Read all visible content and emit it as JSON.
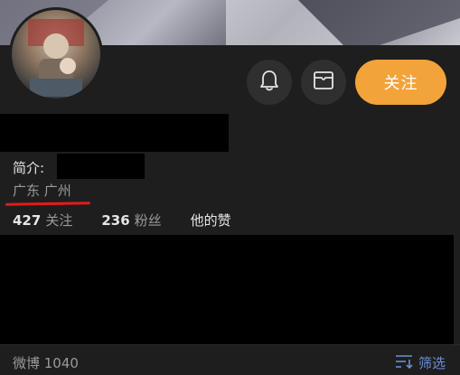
{
  "profile": {
    "bio_label": "简介:",
    "location": "广东 广州"
  },
  "actions": {
    "follow_label": "关注"
  },
  "stats": [
    {
      "count": "427",
      "label": "关注"
    },
    {
      "count": "236",
      "label": "粉丝"
    },
    {
      "count": "",
      "label": "他的赞"
    }
  ],
  "footer": {
    "weibo_count": "微博 1040",
    "filter_label": "筛选"
  },
  "colors": {
    "accent": "#f2a33a",
    "link": "#6b8fd6",
    "annotation": "#e51a1a"
  },
  "icons": [
    "bell-icon",
    "mail-icon",
    "filter-icon"
  ]
}
